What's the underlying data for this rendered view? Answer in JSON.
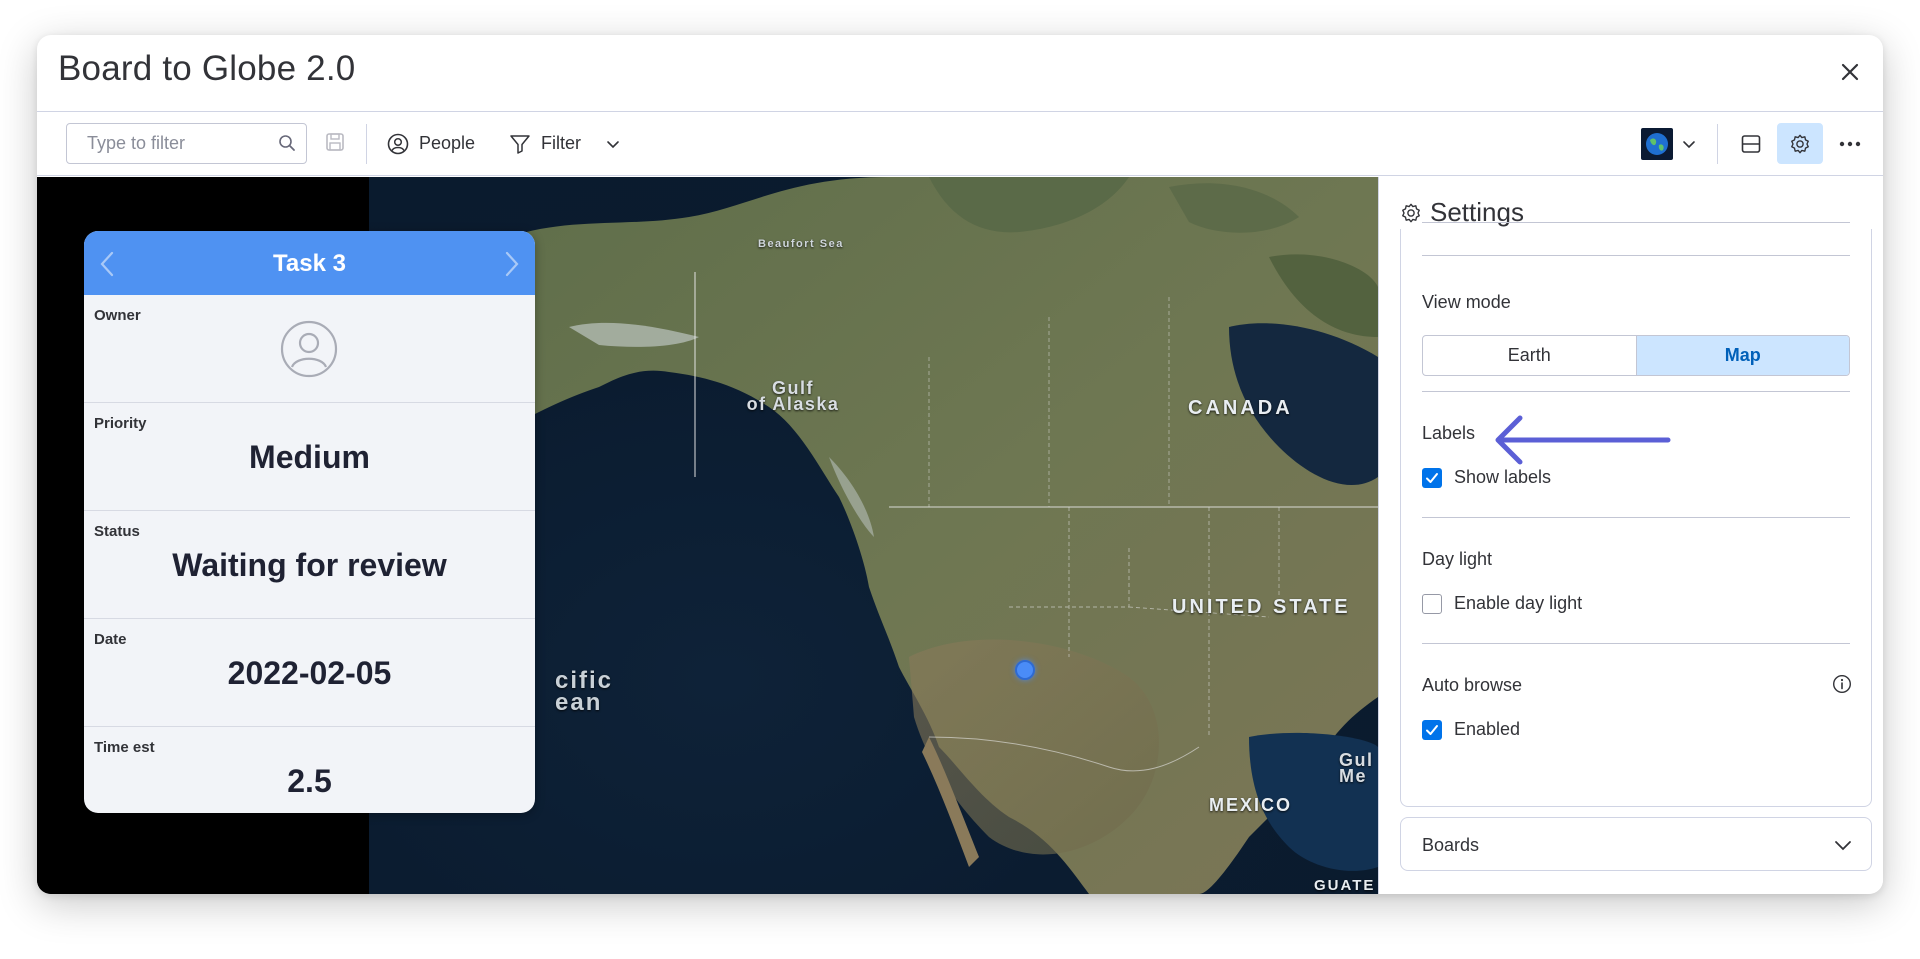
{
  "window": {
    "title": "Board to Globe 2.0"
  },
  "toolbar": {
    "search_placeholder": "Type to filter",
    "people_label": "People",
    "filter_label": "Filter"
  },
  "map": {
    "labels": {
      "beaufort": "Beaufort Sea",
      "gulf_alaska_1": "Gulf",
      "gulf_alaska_2": "of Alaska",
      "canada": "CANADA",
      "usa": "UNITED STATE",
      "pacific_1": "cific",
      "pacific_2": "ean",
      "mexico": "MEXICO",
      "gulf_mexico_1": "Gul",
      "gulf_mexico_2": "Me",
      "guatemala": "GUATE"
    }
  },
  "card": {
    "title": "Task 3",
    "rows": [
      {
        "label": "Owner",
        "value": ""
      },
      {
        "label": "Priority",
        "value": "Medium"
      },
      {
        "label": "Status",
        "value": "Waiting for review"
      },
      {
        "label": "Date",
        "value": "2022-02-05"
      },
      {
        "label": "Time est",
        "value": "2.5"
      }
    ]
  },
  "settings": {
    "title": "Settings",
    "view_mode_label": "View mode",
    "view_modes": [
      "Earth",
      "Map"
    ],
    "view_mode_selected": "Map",
    "labels_label": "Labels",
    "show_labels": "Show labels",
    "show_labels_checked": true,
    "day_light_label": "Day light",
    "enable_day_light": "Enable day light",
    "enable_day_light_checked": false,
    "auto_browse_label": "Auto browse",
    "enabled_label": "Enabled",
    "enabled_checked": true,
    "boards_label": "Boards"
  },
  "colors": {
    "accent": "#0073ea",
    "card_header": "#4f92f2",
    "selected_segment_bg": "#cce5ff",
    "annotation_arrow": "#5b5fd6",
    "map_pin": "#4a8cf7"
  }
}
